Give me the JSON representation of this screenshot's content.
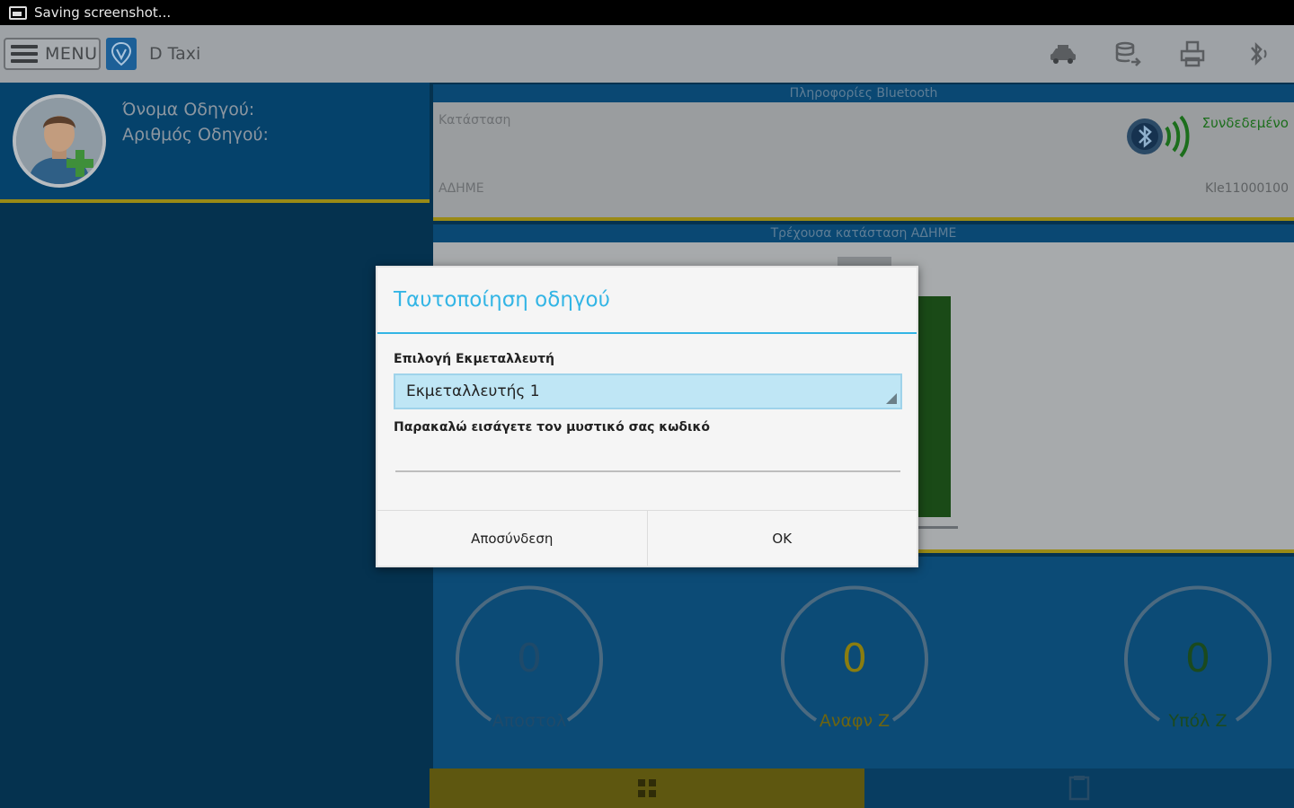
{
  "status_bar": {
    "text": "Saving screenshot..."
  },
  "action_bar": {
    "menu_label": "MENU",
    "app_title": "D Taxi",
    "icons": [
      "taxi-icon",
      "database-sync-icon",
      "printer-icon",
      "bluetooth-icon"
    ]
  },
  "driver": {
    "name_label": "Όνομα Οδηγού:",
    "number_label": "Αριθμός Οδηγού:"
  },
  "bluetooth_panel": {
    "header": "Πληροφορίες Bluetooth",
    "status_label": "Κατάσταση",
    "status_value": "Συνδεδεμένο",
    "adhme_label": "ΑΔΗΜΕ",
    "adhme_value": "Kle11000100"
  },
  "state_panel": {
    "header": "Τρέχουσα κατάσταση ΑΔΗΜΕ"
  },
  "gauges": [
    {
      "value": "0",
      "label": "Αποστολ",
      "color": "#1f4a6a",
      "label_color": "#1f4a6a"
    },
    {
      "value": "0",
      "label": "Αναφν Ζ",
      "color": "#8a7d0f",
      "label_color": "#6d6410"
    },
    {
      "value": "0",
      "label": "Υπόλ Ζ",
      "color": "#1b4a1e",
      "label_color": "#1b4a1e"
    }
  ],
  "dialog": {
    "title": "Ταυτοποίηση οδηγού",
    "operator_label": "Επιλογή Εκμεταλλευτή",
    "operator_selected": "Εκμεταλλευτής 1",
    "password_label": "Παρακαλώ εισάγετε τον μυστικό σας κωδικό",
    "password_value": "",
    "cancel_label": "Αποσύνδεση",
    "ok_label": "OK"
  },
  "colors": {
    "accent": "#33b5e5",
    "dim_overlay_panel": "#05426b",
    "yellow_divider": "#9a8a16"
  }
}
